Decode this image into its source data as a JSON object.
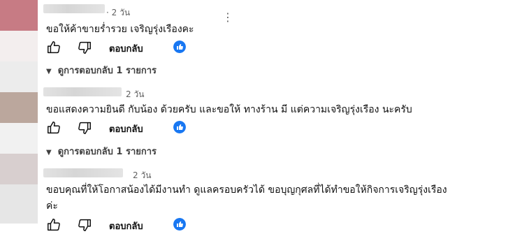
{
  "comments": [
    {
      "time": "· 2 วัน",
      "text": "ขอให้ค้าขายร่ำรวย เจริญรุ่งเรืองคะ",
      "reply_label": "ตอบกลับ",
      "replies_label": "ดูการตอบกลับ 1 รายการ"
    },
    {
      "time": "2 วัน",
      "text": "ขอแสดงความยินดี กับน้อง ด้วยครับ และขอให้ ทางร้าน มี แต่ความเจริญรุ่งเรือง นะครับ",
      "reply_label": "ตอบกลับ",
      "replies_label": "ดูการตอบกลับ 1 รายการ"
    },
    {
      "time": "2 วัน",
      "text_line1": "ขอบคุณที่ให้โอกาสน้องได้มีงานทำ ดูแลครอบครัวได้ ขอบุญกุศลที่ได้ทำขอให้กิจการเจริญรุ่งเรือง",
      "text_line2": "ค่ะ",
      "reply_label": "ตอบกลับ"
    }
  ],
  "icons": {
    "more": "vertical-dots",
    "like": "thumbs-up-outline",
    "dislike": "thumbs-down-outline",
    "reaction": "facebook-like",
    "expand": "chevron-down"
  },
  "colors": {
    "reaction_blue": "#1877f2",
    "text": "#0f0f0f",
    "muted": "#606060"
  }
}
